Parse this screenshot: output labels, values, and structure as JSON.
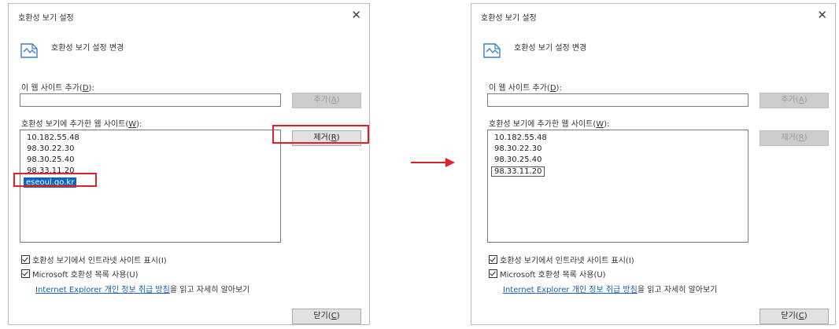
{
  "dialog_left": {
    "title": "호환성 보기 설정",
    "close_glyph": "✕",
    "header_icon": "compat-view-icon",
    "header_text": "호환성 보기 설정 변경",
    "add_site_label_prefix": "이 웹 사이트 추가(",
    "add_site_label_key": "D",
    "add_site_label_suffix": "):",
    "add_site_value": "",
    "add_button_prefix": "추가(",
    "add_button_key": "A",
    "add_button_suffix": ")",
    "list_label_prefix": "호환성 보기에 추가한 웹 사이트(",
    "list_label_key": "W",
    "list_label_suffix": "):",
    "remove_button_prefix": "제거(",
    "remove_button_key": "R",
    "remove_button_suffix": ")",
    "sites": [
      "10.182.55.48",
      "98.30.22.30",
      "98.30.25.40",
      "98.33.11.20",
      "eseoul.go.kr"
    ],
    "selected_site": "eseoul.go.kr",
    "check1_label": "호환성 보기에서 인트라넷 사이트 표시(I)",
    "check1_checked": true,
    "check2_label": "Microsoft 호환성 목록 사용(U)",
    "check2_checked": true,
    "link_text": "Internet Explorer 개인 정보 취급 방침",
    "link_suffix": "을 읽고 자세히 알아보기",
    "close_button_prefix": "닫기(",
    "close_button_key": "C",
    "close_button_suffix": ")"
  },
  "dialog_right": {
    "title": "호환성 보기 설정",
    "close_glyph": "✕",
    "header_icon": "compat-view-icon",
    "header_text": "호환성 보기 설정 변경",
    "add_site_label_prefix": "이 웹 사이트 추가(",
    "add_site_label_key": "D",
    "add_site_label_suffix": "):",
    "add_site_value": "",
    "add_button_prefix": "추가(",
    "add_button_key": "A",
    "add_button_suffix": ")",
    "list_label_prefix": "호환성 보기에 추가한 웹 사이트(",
    "list_label_key": "W",
    "list_label_suffix": "):",
    "remove_button_prefix": "제거(",
    "remove_button_key": "R",
    "remove_button_suffix": ")",
    "sites": [
      "10.182.55.48",
      "98.30.22.30",
      "98.30.25.40",
      "98.33.11.20"
    ],
    "focused_site": "98.33.11.20",
    "check1_label": "호환성 보기에서 인트라넷 사이트 표시(I)",
    "check1_checked": true,
    "check2_label": "Microsoft 호환성 목록 사용(U)",
    "check2_checked": true,
    "link_text": "Internet Explorer 개인 정보 취급 방침",
    "link_suffix": "을 읽고 자세히 알아보기",
    "close_button_prefix": "닫기(",
    "close_button_key": "C",
    "close_button_suffix": ")"
  },
  "annotation": {
    "highlight_color": "#e0202a",
    "arrow_icon": "right-arrow-icon"
  }
}
